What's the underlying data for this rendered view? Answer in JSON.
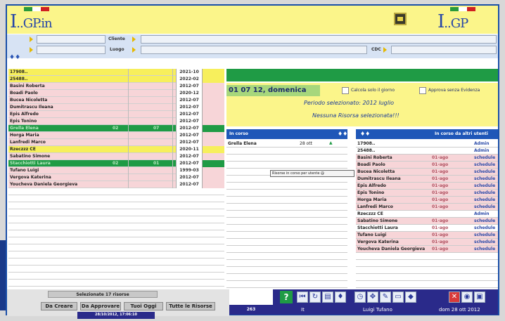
{
  "header": {
    "logo_left": "..GP.in",
    "logo_right": "..GP",
    "logo_left_letter": "I",
    "logo_right_letter": "I",
    "home_icon": "home-icon"
  },
  "filters": {
    "cliente_label": "Cliente",
    "luogo_label": "Luogo",
    "cdc_label": "CDC"
  },
  "left_list": {
    "rows": [
      {
        "name": "17908..",
        "v1": "",
        "v2": "",
        "date": "2021-10",
        "color": "y"
      },
      {
        "name": "25488..",
        "v1": "",
        "v2": "",
        "date": "2022-02",
        "color": "y"
      },
      {
        "name": "Basini Roberta",
        "v1": "",
        "v2": "",
        "date": "2012-07",
        "color": "p"
      },
      {
        "name": "Boadi Paolo",
        "v1": "",
        "v2": "",
        "date": "2020-12",
        "color": "p"
      },
      {
        "name": "Bucea Nicoletta",
        "v1": "",
        "v2": "",
        "date": "2012-07",
        "color": "p"
      },
      {
        "name": "Dumitrascu Ileana",
        "v1": "",
        "v2": "",
        "date": "2012-07",
        "color": "p"
      },
      {
        "name": "Epis Alfredo",
        "v1": "",
        "v2": "",
        "date": "2012-07",
        "color": "p"
      },
      {
        "name": "Epis Tonino",
        "v1": "",
        "v2": "",
        "date": "2012-07",
        "color": "p"
      },
      {
        "name": "Grella Elena",
        "v1": "02",
        "v2": "07",
        "date": "2012-07",
        "color": "g"
      },
      {
        "name": "Horga Maria",
        "v1": "",
        "v2": "",
        "date": "2012-07",
        "color": "p"
      },
      {
        "name": "Lanfredi Marco",
        "v1": "",
        "v2": "",
        "date": "2012-07",
        "color": "p"
      },
      {
        "name": "Rzeczzz CE",
        "v1": "",
        "v2": "",
        "date": "2020-11",
        "color": "y"
      },
      {
        "name": "Sabatino Simone",
        "v1": "",
        "v2": "",
        "date": "2012-07",
        "color": "p"
      },
      {
        "name": "Stacchiotti Laura",
        "v1": "02",
        "v2": "01",
        "date": "2012-07",
        "color": "g"
      },
      {
        "name": "Tufano Luigi",
        "v1": "",
        "v2": "",
        "date": "1999-03",
        "color": "p"
      },
      {
        "name": "Vergova Katerina",
        "v1": "",
        "v2": "",
        "date": "2012-07",
        "color": "p"
      },
      {
        "name": "Youcheva Daniela Georgieva",
        "v1": "",
        "v2": "",
        "date": "2012-07",
        "color": "p"
      }
    ]
  },
  "left_footer": {
    "selected_label": "Selezionate 17 risorse",
    "btn_da_creare": "Da Creare",
    "btn_da_approvare": "Da Approvare",
    "btn_tuoi_oggi": "Tuoi Oggi",
    "btn_tutte": "Tutte le Risorse",
    "timestamp": "28/10/2012, 17:06:10",
    "count": "263"
  },
  "date_panel": {
    "date": "01 07 12, domenica",
    "calc_label": "Calcola solo il giorno",
    "approve_label": "Approva senza Evidenza",
    "period": "Periodo selezionato: 2012 luglio",
    "none_selected": "Nessuna Risorsa selezionata!!!"
  },
  "mid_panel": {
    "header": "In corso",
    "rows": [
      {
        "name": "Grella Elena",
        "val": "28 ott"
      }
    ],
    "tooltip": "Risorse in corso per utente @"
  },
  "right_panel": {
    "header": "In corso da altri utenti",
    "rows": [
      {
        "name": "17908..",
        "date": "",
        "status": "Admin",
        "pink": false
      },
      {
        "name": "25488..",
        "date": "",
        "status": "Admin",
        "pink": false
      },
      {
        "name": "Basini Roberta",
        "date": "01-ago",
        "status": "schedule",
        "pink": true
      },
      {
        "name": "Boadi Paolo",
        "date": "01-ago",
        "status": "schedule",
        "pink": true
      },
      {
        "name": "Bucea Nicoletta",
        "date": "01-ago",
        "status": "schedule",
        "pink": true
      },
      {
        "name": "Dumitrascu Ileana",
        "date": "01-ago",
        "status": "schedule",
        "pink": true
      },
      {
        "name": "Epis Alfredo",
        "date": "01-ago",
        "status": "schedule",
        "pink": true
      },
      {
        "name": "Epis Tonino",
        "date": "01-ago",
        "status": "schedule",
        "pink": true
      },
      {
        "name": "Horga Maria",
        "date": "01-ago",
        "status": "schedule",
        "pink": true
      },
      {
        "name": "Lanfredi Marco",
        "date": "01-ago",
        "status": "schedule",
        "pink": true
      },
      {
        "name": "Rzeczzz CE",
        "date": "",
        "status": "Admin",
        "pink": false
      },
      {
        "name": "Sabatino Simone",
        "date": "01-ago",
        "status": "schedule",
        "pink": true
      },
      {
        "name": "Stacchiotti Laura",
        "date": "01-ago",
        "status": "schedule",
        "pink": false
      },
      {
        "name": "Tufano Luigi",
        "date": "01-ago",
        "status": "schedule",
        "pink": true
      },
      {
        "name": "Vergova Katerina",
        "date": "01-ago",
        "status": "schedule",
        "pink": true
      },
      {
        "name": "Youcheva Daniela Georgieva",
        "date": "01-ago",
        "status": "schedule",
        "pink": true
      }
    ]
  },
  "toolbar": {
    "help": "?",
    "icons": [
      "first-icon",
      "refresh-icon",
      "print-icon",
      "people-icon",
      "clock-icon",
      "move-icon",
      "edit-icon",
      "book-icon",
      "diamond-icon",
      "close-icon",
      "eye-icon",
      "save-icon"
    ]
  },
  "status_bar": {
    "lang": "It",
    "user": "Luigi Tufano",
    "date": "dom 28 ott 2012"
  }
}
